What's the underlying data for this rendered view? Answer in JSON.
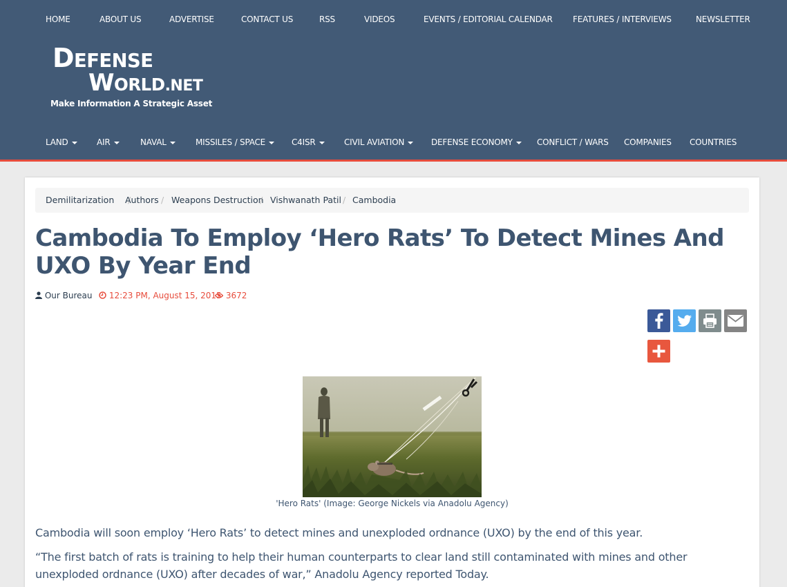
{
  "top_nav": [
    "HOME",
    "ABOUT US",
    "ADVERTISE",
    "CONTACT US",
    "RSS",
    "VIDEOS",
    "EVENTS / EDITORIAL CALENDAR",
    "FEATURES / INTERVIEWS",
    "NEWSLETTER"
  ],
  "logo": {
    "line1_initial": "D",
    "line1_rest": "EFENSE",
    "line2_initial": "W",
    "line2_rest": "ORLD",
    "line2_suffix": ".NET",
    "tagline": "Make Information A Strategic Asset"
  },
  "cat_nav": [
    "LAND",
    "AIR",
    "NAVAL",
    "MISSILES / SPACE",
    "C4ISR",
    "CIVIL AVIATION",
    "DEFENSE ECONOMY",
    "CONFLICT / WARS",
    "COMPANIES",
    "COUNTRIES"
  ],
  "breadcrumb": [
    "Demilitarization",
    "Authors",
    "Weapons Destruction",
    "Vishwanath Patil",
    "Cambodia"
  ],
  "breadcrumb_sep": "/",
  "article": {
    "title": "Cambodia To Employ ‘Hero Rats’ To Detect Mines And UXO By Year End",
    "author": "Our Bureau",
    "date": "12:23 PM, August 15, 2015",
    "views": "3672",
    "caption": "'Hero Rats' (Image: George Nickels via Anadolu Agency)",
    "paragraphs": [
      "Cambodia will soon employ ‘Hero Rats’ to detect mines and unexploded ordnance (UXO) by the end of this year.",
      "“The first batch of rats is training to help their human counterparts to clear land still contaminated with mines and other unexploded ordnance (UXO) after decades of war,”  Anadolu Agency reported Today."
    ]
  },
  "share_buttons": [
    {
      "name": "facebook-icon",
      "color": "#3b5998"
    },
    {
      "name": "twitter-icon",
      "color": "#55acee"
    },
    {
      "name": "print-icon",
      "color": "#7f8c8d"
    },
    {
      "name": "email-icon",
      "color": "#848484"
    },
    {
      "name": "plus-icon",
      "color": "#e8573e"
    }
  ],
  "colors": {
    "header_bg": "#425a76",
    "accent": "#e74c3c",
    "title": "#3e5570"
  }
}
